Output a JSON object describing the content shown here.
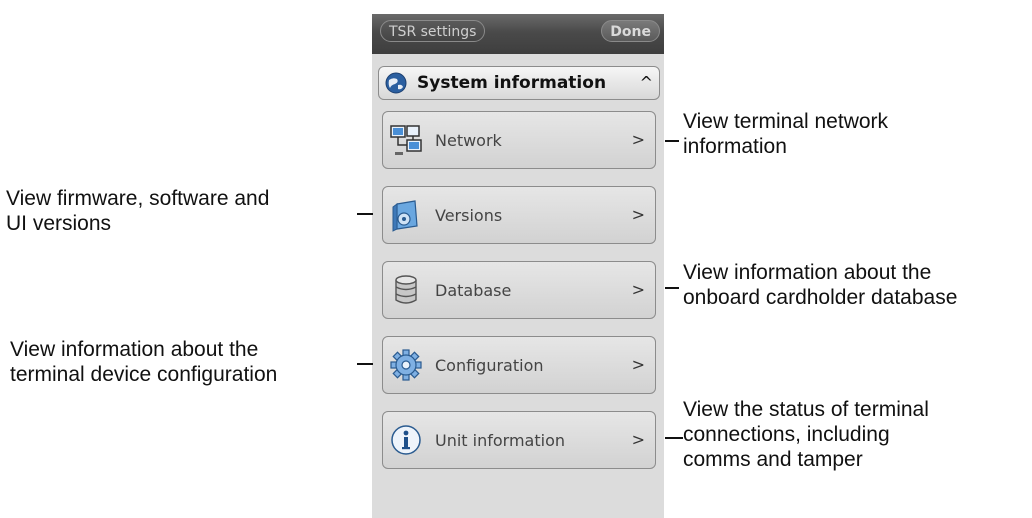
{
  "titlebar": {
    "title_label": "TSR settings",
    "done_label": "Done"
  },
  "section": {
    "title": "System information",
    "caret": "^",
    "icon": "globe-icon"
  },
  "menu": [
    {
      "label": "Network",
      "chevron": ">",
      "icon": "network-computers-icon"
    },
    {
      "label": "Versions",
      "chevron": ">",
      "icon": "versions-box-icon"
    },
    {
      "label": "Database",
      "chevron": ">",
      "icon": "database-icon"
    },
    {
      "label": "Configuration",
      "chevron": ">",
      "icon": "gear-icon"
    },
    {
      "label": "Unit information",
      "chevron": ">",
      "icon": "info-icon"
    }
  ],
  "callouts": {
    "network": [
      "View terminal network",
      "information"
    ],
    "versions": [
      "View firmware, software and",
      "UI versions"
    ],
    "database": [
      "View information about the",
      "onboard cardholder database"
    ],
    "configuration": [
      "View information about the",
      "terminal device configuration"
    ],
    "unit_information": [
      "View the status of terminal",
      "connections, including",
      "comms and tamper"
    ]
  },
  "colors": {
    "titlebar": "#4a4a4a",
    "screen_bg": "#dcdcdc",
    "button_border": "#8c8c8c",
    "accent_blue": "#2b6fb8"
  }
}
